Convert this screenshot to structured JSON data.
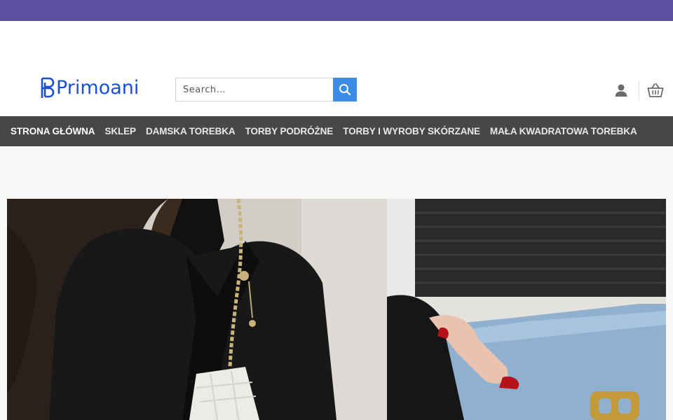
{
  "brand": {
    "name": "Primoani",
    "accent": "#1a4fd8",
    "topbar_color": "#5b4fa3"
  },
  "search": {
    "placeholder": "Search…"
  },
  "icons": {
    "search": "search-icon",
    "account": "user-icon",
    "cart": "basket-icon"
  },
  "nav": {
    "items": [
      {
        "label": "STRONA GŁÓWNA"
      },
      {
        "label": "SKLEP"
      },
      {
        "label": "DAMSKA TOREBKA"
      },
      {
        "label": "TORBY PODRÓŻNE"
      },
      {
        "label": "TORBY I WYROBY SKÓRZANE"
      },
      {
        "label": "MAŁA KWADRATOWA TOREBKA"
      }
    ]
  }
}
